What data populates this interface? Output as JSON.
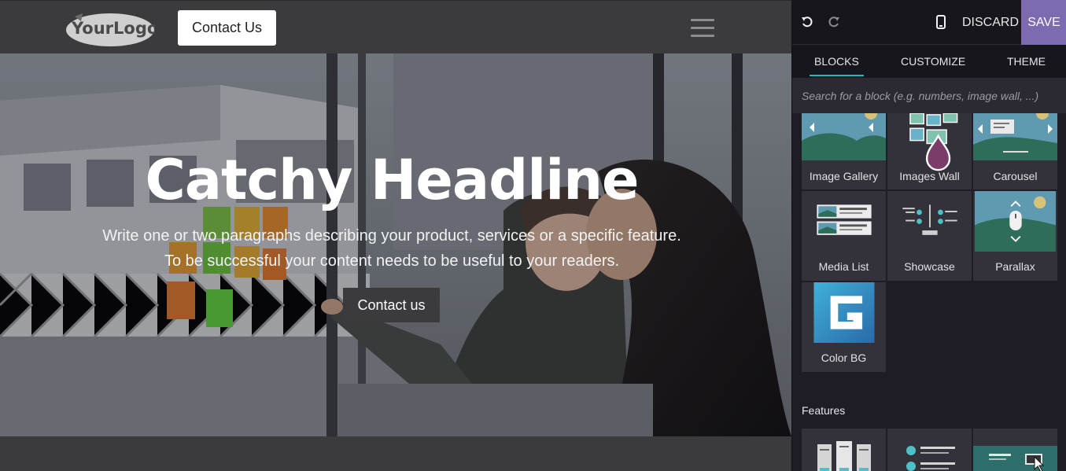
{
  "site": {
    "logo_text": "YourLogo",
    "header_button": "Contact Us",
    "hero": {
      "title": "Catchy Headline",
      "paragraph_line1": "Write one or two paragraphs describing your product, services or a specific feature.",
      "paragraph_line2": "To be successful your content needs to be useful to your readers.",
      "button": "Contact us"
    }
  },
  "editor": {
    "toolbar": {
      "undo_icon": "undo-icon",
      "redo_icon": "redo-icon",
      "mobile_icon": "mobile-preview-icon",
      "discard_label": "DISCARD",
      "save_label": "SAVE"
    },
    "tabs": [
      {
        "label": "BLOCKS",
        "active": true
      },
      {
        "label": "CUSTOMIZE",
        "active": false
      },
      {
        "label": "THEME",
        "active": false
      }
    ],
    "search_placeholder": "Search for a block (e.g. numbers, image wall, ...)",
    "blocks": [
      {
        "label": "Image Gallery"
      },
      {
        "label": "Images Wall"
      },
      {
        "label": "Carousel"
      },
      {
        "label": "Media List"
      },
      {
        "label": "Showcase"
      },
      {
        "label": "Parallax"
      },
      {
        "label": "Color BG"
      }
    ],
    "features_title": "Features"
  },
  "colors": {
    "accent": "#7c6bb0",
    "tab_underline": "#24b6c7",
    "panel_bg": "#1e1d26"
  }
}
